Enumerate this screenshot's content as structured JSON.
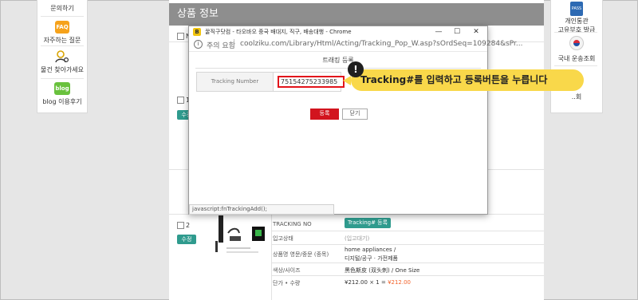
{
  "left_sidebar": {
    "items": [
      {
        "label": "문의하기"
      },
      {
        "label": "자주하는 질문",
        "icon_text": "FAQ"
      },
      {
        "label": "물건 찾아가세요"
      },
      {
        "label": "blog 이용후기",
        "icon_text": "blog"
      }
    ]
  },
  "right_sidebar": {
    "items": [
      {
        "label_line1": "개인통관",
        "label_line2": "고유부호 발급",
        "icon_text": "PASS"
      },
      {
        "label": "국내 운송조회"
      },
      {
        "label": "..회"
      }
    ]
  },
  "main": {
    "section_title": "상품 정보",
    "header_check_label": "N",
    "row1": {
      "number": "1",
      "edit_button": "수정"
    },
    "row2": {
      "number": "2",
      "edit_button": "수정"
    },
    "details": {
      "tracking_label": "TRACKING NO",
      "tracking_button": "Tracking# 등록",
      "status_label": "입고상태",
      "status_value": "(입고대기)",
      "name_label": "상품명 영문/중문 (종목)",
      "name_value_line1": "home appliances /",
      "name_value_line2": "디지털/공구 · 가전제품",
      "option_label": "색상/사이즈",
      "option_value": "黑色斯皮 (双头刺)  / One Size",
      "price_label": "단가 • 수량",
      "price_unit": "¥212.00",
      "price_qty": "× 1 =",
      "price_total": "¥212.00"
    }
  },
  "popup": {
    "window_title": "꿀직구닷컴 - 타오바오 중국 배대지, 직구, 배송대행 - Chrome",
    "app_icon_text": "B",
    "controls": {
      "minimize": "—",
      "maximize": "☐",
      "close": "✕"
    },
    "address": {
      "info_text": "i",
      "warning": "주의 요함",
      "separator": "|",
      "url": "coolziku.com/Library/Html/Acting/Tracking_Pop_W.asp?sOrdSeq=109284&sPr..."
    },
    "title": "트래킹 등록",
    "field_label": "Tracking Number",
    "field_value": "75154275233985",
    "submit_button": "등록",
    "close_button": "닫기",
    "status_text": "javascript:fnTrackingAdd();"
  },
  "callout": {
    "mark": "!",
    "text": "Tracking#를 입력하고 등록버튼을 누릅니다"
  }
}
